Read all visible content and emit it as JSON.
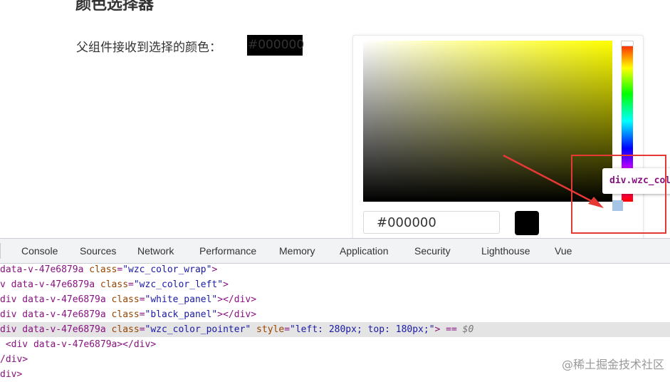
{
  "page": {
    "heading": "颜色选择器",
    "picked_label": "父组件接收到选择的颜色：",
    "picked_value": "#000000"
  },
  "picker": {
    "hex_value": "#000000",
    "swatch_color": "#000000",
    "base_hue_color": "#ffff00"
  },
  "tooltip": {
    "text": "div.wzc_color_pointer"
  },
  "devtools": {
    "tabs": [
      "Console",
      "Sources",
      "Network",
      "Performance",
      "Memory",
      "Application",
      "Security",
      "Lighthouse",
      "Vue"
    ],
    "lines": [
      {
        "prefix": "data-v-47e6879a ",
        "attr1": "class",
        "val1": "\"wzc_color_wrap\"",
        "suffix": ">"
      },
      {
        "prefix": "v data-v-47e6879a ",
        "attr1": "class",
        "val1": "\"wzc_color_left\"",
        "suffix": ">"
      },
      {
        "prefix": "div data-v-47e6879a ",
        "attr1": "class",
        "val1": "\"white_panel\"",
        "suffix": "></div>"
      },
      {
        "prefix": "div data-v-47e6879a ",
        "attr1": "class",
        "val1": "\"black_panel\"",
        "suffix": "></div>"
      },
      {
        "prefix": "div data-v-47e6879a ",
        "attr1": "class",
        "val1": "\"wzc_color_pointer\"",
        "mid": " style",
        "val2": "\"left: 280px; top: 180px;\"",
        "suffix": "> == ",
        "dollar": "$0"
      },
      {
        "prefix": " <div data-v-47e6879a></div>"
      },
      {
        "prefix": "/div>"
      },
      {
        "prefix": "div>"
      }
    ]
  },
  "watermark": "@稀土掘金技术社区",
  "colors": {
    "annotation_red": "#e53935",
    "code_tag": "#881280",
    "code_attr": "#994500",
    "code_value": "#1a1aa6"
  }
}
